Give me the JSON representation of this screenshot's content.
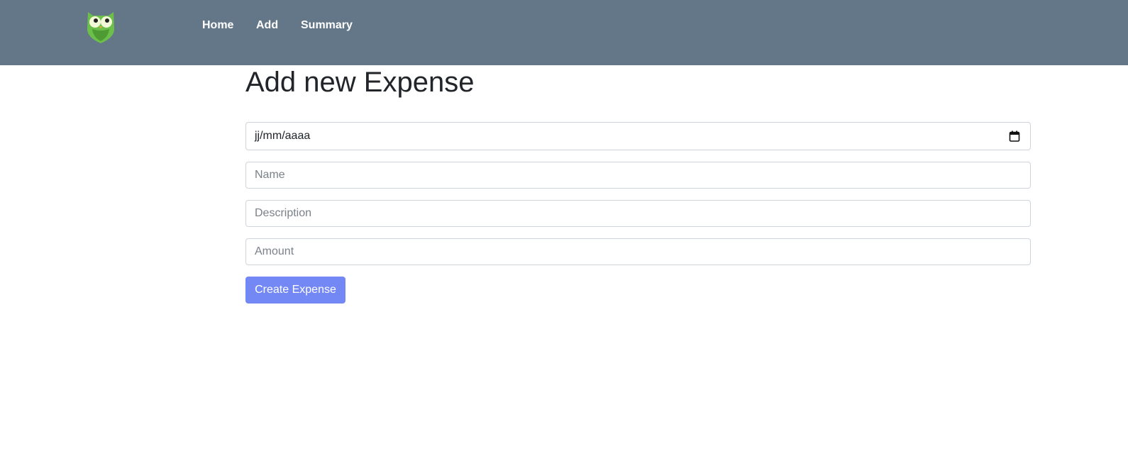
{
  "nav": {
    "logo_icon": "owl-logo-icon",
    "links": [
      {
        "label": "Home"
      },
      {
        "label": "Add"
      },
      {
        "label": "Summary"
      }
    ]
  },
  "form": {
    "title": "Add new Expense",
    "date": {
      "display": "jj/mm/aaaa",
      "icon": "calendar-icon"
    },
    "name": {
      "placeholder": "Name",
      "value": ""
    },
    "description": {
      "placeholder": "Description",
      "value": ""
    },
    "amount": {
      "placeholder": "Amount",
      "value": ""
    },
    "submit_label": "Create Expense"
  },
  "colors": {
    "navbar_bg": "#647788",
    "button_bg": "#7488f5",
    "logo_green": "#6cc04a"
  }
}
